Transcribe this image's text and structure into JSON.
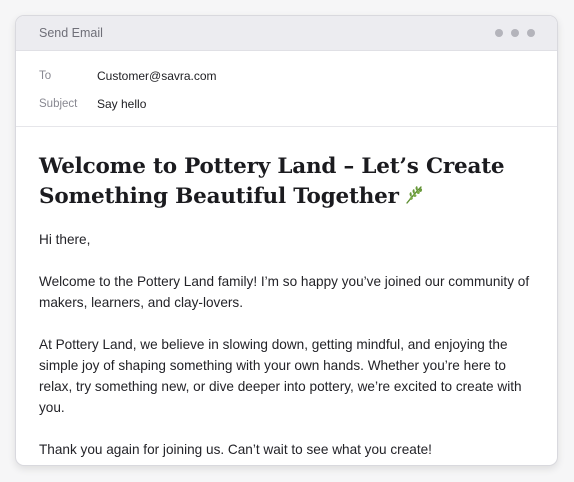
{
  "window": {
    "title": "Send Email"
  },
  "email": {
    "to_label": "To",
    "to_value": "Customer@savra.com",
    "subject_label": "Subject",
    "subject_value": "Say hello"
  },
  "body": {
    "heading": "Welcome to Pottery Land – Let’s Create Something Beautiful Together",
    "heading_icon": "leaf-icon",
    "paragraphs": [
      "Hi there,",
      "Welcome to the Pottery Land family! I’m so happy you’ve joined our community of makers, learners, and clay-lovers.",
      "At Pottery Land, we believe in slowing down, getting mindful, and enjoying the simple joy of shaping something with your own hands. Whether you’re here to relax, try something new, or dive deeper into pottery, we’re excited to create with you.",
      "Thank you again for joining us. Can’t wait to see what you create!"
    ]
  },
  "colors": {
    "titlebar": "#ececf0",
    "leaf": "#6a9a3c"
  }
}
